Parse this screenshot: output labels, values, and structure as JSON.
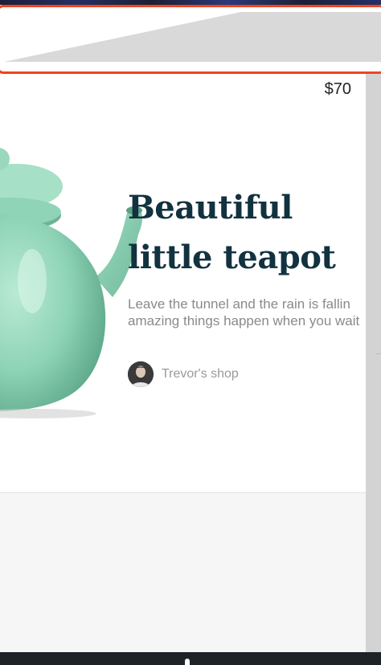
{
  "product": {
    "price": "$70",
    "title_line1": "Beautiful",
    "title_line2": "little teapot",
    "description": "Leave the tunnel and the rain is fallin amazing things happen when you wait",
    "image_icon": "teapot-image"
  },
  "shop": {
    "name": "Trevor's shop",
    "avatar_icon": "avatar"
  },
  "colors": {
    "highlight_border": "#f0441e",
    "title_text": "#12323f",
    "teapot_green": "#8fd4b7"
  }
}
